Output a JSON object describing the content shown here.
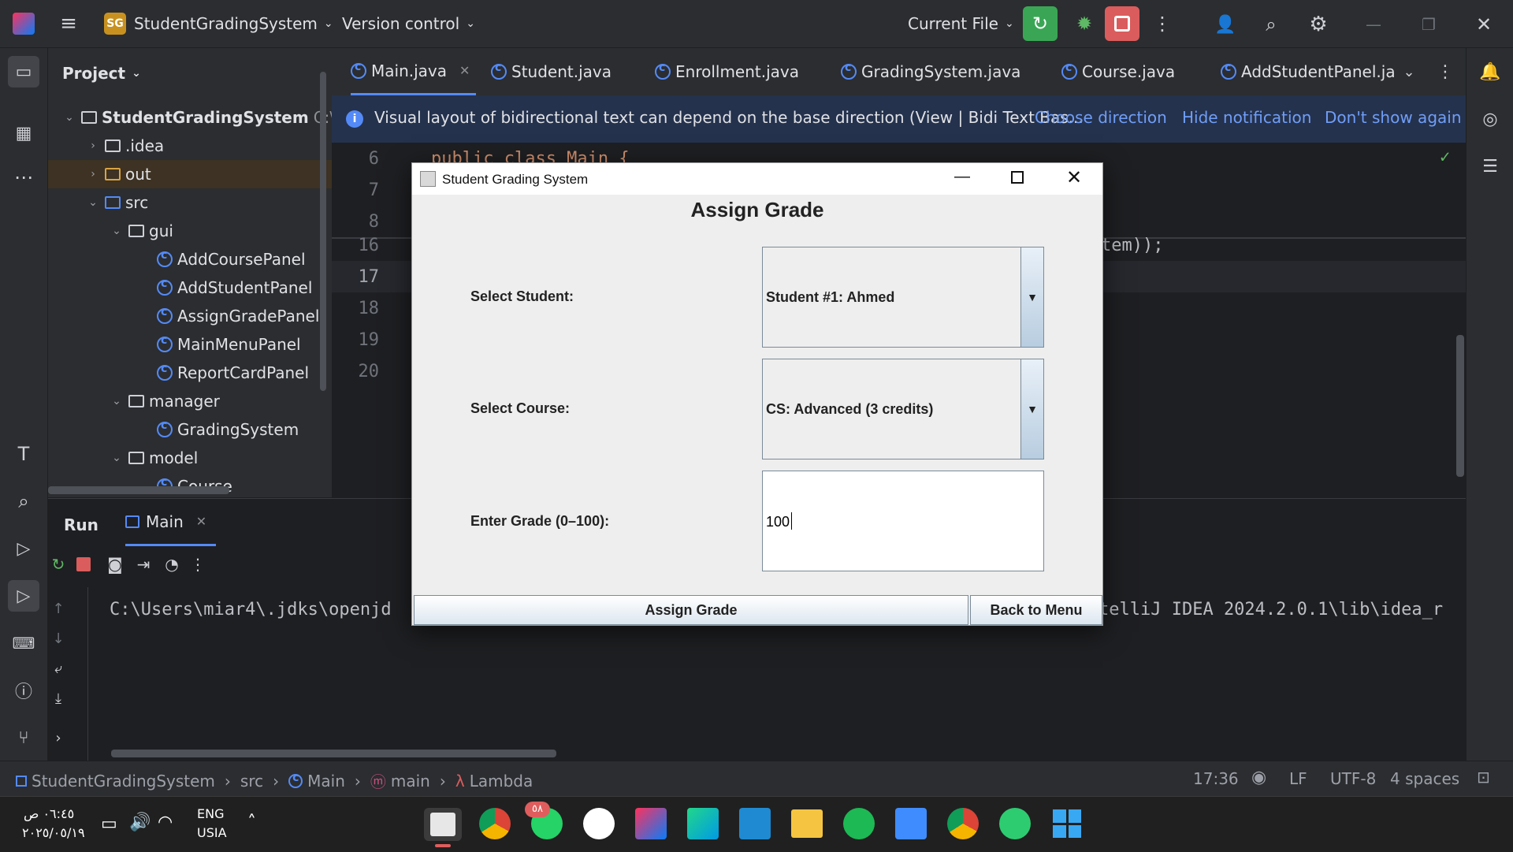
{
  "titlebar": {
    "project_badge": "SG",
    "project_name": "StudentGradingSystem",
    "vcs": "Version control",
    "run_config": "Current File"
  },
  "project_panel": {
    "title": "Project",
    "root": "StudentGradingSystem",
    "root_path": "C:\\",
    "items": [
      {
        "label": ".idea"
      },
      {
        "label": "out"
      },
      {
        "label": "src"
      },
      {
        "label": "gui"
      },
      {
        "label": "AddCoursePanel"
      },
      {
        "label": "AddStudentPanel"
      },
      {
        "label": "AssignGradePanel"
      },
      {
        "label": "MainMenuPanel"
      },
      {
        "label": "ReportCardPanel"
      },
      {
        "label": "manager"
      },
      {
        "label": "GradingSystem"
      },
      {
        "label": "model"
      },
      {
        "label": "Course"
      }
    ]
  },
  "tabs": [
    {
      "label": "Main.java"
    },
    {
      "label": "Student.java"
    },
    {
      "label": "Enrollment.java"
    },
    {
      "label": "GradingSystem.java"
    },
    {
      "label": "Course.java"
    },
    {
      "label": "AddStudentPanel.ja"
    }
  ],
  "notification": {
    "text": "Visual layout of bidirectional text can depend on the base direction (View | Bidi Text Bas...",
    "choose": "Choose direction",
    "hide": "Hide notification",
    "dont_show": "Don't show again"
  },
  "editor": {
    "lines": [
      "6",
      "7",
      "8",
      "16",
      "17",
      "18",
      "19",
      "20"
    ],
    "code_top": "public class Main {",
    "code_right": "tem));"
  },
  "run_panel": {
    "title": "Run",
    "tab": "Main",
    "console_left": "C:\\Users\\miar4\\.jdks\\openjd",
    "console_right": "telliJ IDEA 2024.2.0.1\\lib\\idea_r"
  },
  "status": {
    "crumbs": [
      "StudentGradingSystem",
      "src",
      "Main",
      "main",
      "Lambda"
    ],
    "position": "17:36",
    "line_sep": "LF",
    "encoding": "UTF-8",
    "indent": "4 spaces"
  },
  "dialog": {
    "window_title": "Student Grading System",
    "heading": "Assign Grade",
    "student_label": "Select Student:",
    "student_value": "Student #1: Ahmed",
    "course_label": "Select Course:",
    "course_value": "CS: Advanced (3 credits)",
    "grade_label": "Enter Grade (0–100):",
    "grade_value": "100",
    "assign_button": "Assign Grade",
    "back_button": "Back to Menu"
  },
  "taskbar": {
    "time": "٠٦:٤٥ ص",
    "date": "٢٠٢٥/٠٥/١٩",
    "lang1": "ENG",
    "lang2": "USIA",
    "whatsapp_badge": "٥٨"
  },
  "colors": {
    "accent": "#548af7",
    "run_green": "#3aa655",
    "stop_red": "#db5c5c"
  }
}
